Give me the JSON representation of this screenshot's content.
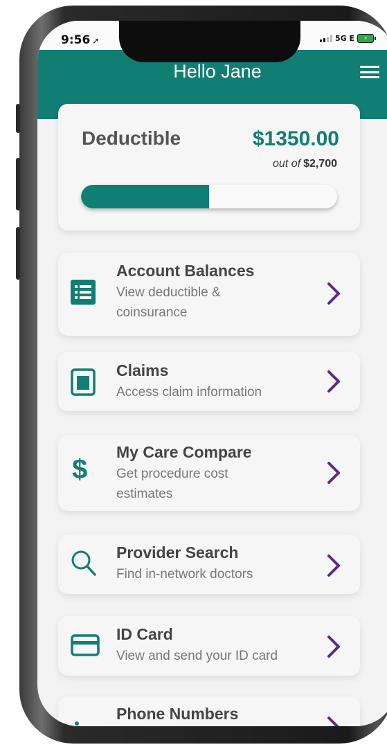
{
  "status_bar": {
    "time": "9:56",
    "network": "5G E"
  },
  "header": {
    "title": "Hello Jane"
  },
  "deductible": {
    "label": "Deductible",
    "amount": "$1350.00",
    "out_of_prefix": "out of",
    "out_of_total": "$2,700",
    "progress_fraction": 0.5
  },
  "menu": {
    "items": [
      {
        "title": "Account Balances",
        "subtitle": "View deductible & coinsurance",
        "icon": "list-icon"
      },
      {
        "title": "Claims",
        "subtitle": "Access claim information",
        "icon": "document-icon"
      },
      {
        "title": "My Care Compare",
        "subtitle": "Get procedure cost estimates",
        "icon": "dollar-icon"
      },
      {
        "title": "Provider Search",
        "subtitle": "Find in-network doctors",
        "icon": "search-icon"
      },
      {
        "title": "ID Card",
        "subtitle": "View and send your ID card",
        "icon": "card-icon"
      },
      {
        "title": "Phone Numbers",
        "subtitle": "",
        "icon": "phone-icon"
      }
    ]
  },
  "colors": {
    "brand": "#117e74",
    "chevron": "#5b2a86",
    "card": "#f6f6f6"
  }
}
